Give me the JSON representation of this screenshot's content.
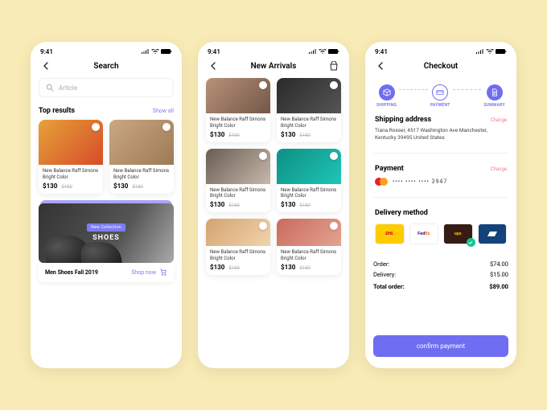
{
  "status_time": "9:41",
  "screen1": {
    "title": "Search",
    "search_placeholder": "Article",
    "top_results_label": "Top results",
    "show_all": "Show all",
    "products": [
      {
        "name": "New Balance Raff Simons Bright Color",
        "price": "$130",
        "old_price": "$180"
      },
      {
        "name": "New Balance Raff Simons Bright Color",
        "price": "$130",
        "old_price": "$180"
      }
    ],
    "banner_badge": "New Collection",
    "banner_title": "SHOES",
    "banner_cta_title": "Men Shoes Fall 2019",
    "banner_cta_btn": "Shop now"
  },
  "screen2": {
    "title": "New Arrivals",
    "products": [
      {
        "name": "New Balance Raff Simons Bright Color",
        "price": "$130",
        "old_price": "$180"
      },
      {
        "name": "New Balance Raff Simons Bright Color",
        "price": "$130",
        "old_price": "$180"
      },
      {
        "name": "New Balance Raff Simons Bright Color",
        "price": "$130",
        "old_price": "$180"
      },
      {
        "name": "New Balance Raff Simons Bright Color",
        "price": "$130",
        "old_price": "$180"
      },
      {
        "name": "New Balance Raff Simons Bright Color",
        "price": "$130",
        "old_price": "$180"
      },
      {
        "name": "New Balance Raff Simons Bright Color",
        "price": "$130",
        "old_price": "$180"
      }
    ]
  },
  "screen3": {
    "title": "Checkout",
    "steps": {
      "shipping": "SHIPPING",
      "payment": "PAYMENT",
      "summary": "SUMMARY"
    },
    "shipping_label": "Shipping address",
    "change": "Change",
    "address": "Tiana Rosser, 4517 Washington Ave Manchester, Kentucky 39495 United States",
    "payment_label": "Payment",
    "card_masked": "•••• •••• •••• 3947",
    "delivery_label": "Delivery method",
    "carriers": {
      "dhl": "DHL",
      "fedex_a": "Fed",
      "fedex_b": "Ex",
      "ups": "ups"
    },
    "selected_carrier": "ups",
    "order_label": "Order:",
    "order_value": "$74.00",
    "delivery_charge_label": "Delivery:",
    "delivery_value": "$15.00",
    "total_label": "Total order:",
    "total_value": "$89.00",
    "confirm_label": "confirm payment"
  }
}
